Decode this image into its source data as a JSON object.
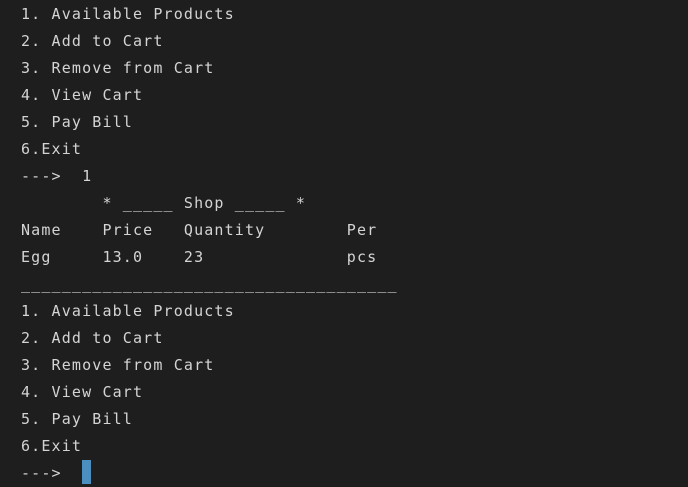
{
  "terminal": {
    "lines": [
      "1. Available Products",
      "2. Add to Cart",
      "3. Remove from Cart",
      "4. View Cart",
      "5. Pay Bill",
      "6.Exit",
      "--->  1",
      "        * _____ Shop _____ *",
      "Name    Price   Quantity        Per",
      "Egg     13.0    23              pcs",
      "_____________________________________",
      "1. Available Products",
      "2. Add to Cart",
      "3. Remove from Cart",
      "4. View Cart",
      "5. Pay Bill",
      "6.Exit"
    ],
    "prompt": "--->  ",
    "colors": {
      "background": "#1e1e1e",
      "text": "#d4d4d4",
      "cursor": "#4a8fc0"
    }
  }
}
